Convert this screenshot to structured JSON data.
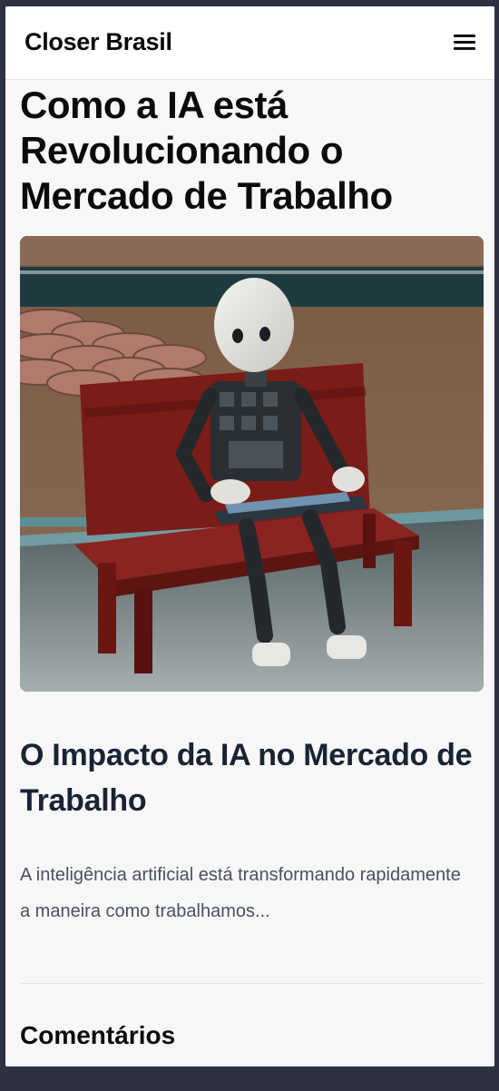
{
  "header": {
    "brand": "Closer Brasil",
    "menu_icon": "hamburger-menu-icon"
  },
  "article": {
    "title": "Como a IA está Revolucionando o Mercado de Trabalho",
    "hero_image_alt": "robot-on-bench-with-laptop",
    "section_title": "O Impacto da IA no Mercado de Trabalho",
    "summary": "A inteligência artificial está transformando rapidamente a maneira como trabalhamos..."
  },
  "comments": {
    "title": "Comentários"
  },
  "colors": {
    "page_background": "#f7f7f8",
    "outer_background": "#2e3142",
    "section_title": "#1a2333",
    "body_text": "#4a5160"
  }
}
